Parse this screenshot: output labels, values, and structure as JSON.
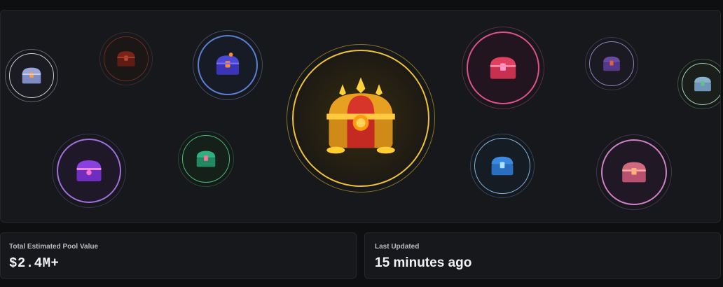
{
  "chests": [
    {
      "id": "chest-silver-left",
      "ring": "#c9c9d6",
      "body": "#9aa6d8",
      "accent": "#ff9a3c"
    },
    {
      "id": "chest-red",
      "ring": "#8a3a2a",
      "body": "#7a2418",
      "accent": "#c0462e"
    },
    {
      "id": "chest-blue",
      "ring": "#5a7fd6",
      "body": "#4a49d8",
      "accent": "#ff8a30"
    },
    {
      "id": "chest-golden-legendary",
      "ring": "#f2c230",
      "body": "#e8a020",
      "accent": "#d8352a"
    },
    {
      "id": "chest-pink",
      "ring": "#e0508a",
      "body": "#e04060",
      "accent": "#ff9ad0"
    },
    {
      "id": "chest-purple-small",
      "ring": "#8f7fc0",
      "body": "#6a4aa0",
      "accent": "#e06040"
    },
    {
      "id": "chest-teal-right",
      "ring": "#9fd0a8",
      "body": "#8ab0d0",
      "accent": "#60c090"
    },
    {
      "id": "chest-violet",
      "ring": "#a070e0",
      "body": "#8a40e0",
      "accent": "#ff70d0"
    },
    {
      "id": "chest-green",
      "ring": "#40c070",
      "body": "#30b080",
      "accent": "#ff70a0"
    },
    {
      "id": "chest-cyan",
      "ring": "#7fb6e6",
      "body": "#3a8ae0",
      "accent": "#b0e0ff"
    },
    {
      "id": "chest-rose",
      "ring": "#d080c8",
      "body": "#d06880",
      "accent": "#ffb070"
    }
  ],
  "stats": {
    "pool_label": "Total Estimated Pool Value",
    "pool_value": "$2.4M+",
    "updated_label": "Last Updated",
    "updated_value": "15 minutes ago"
  }
}
